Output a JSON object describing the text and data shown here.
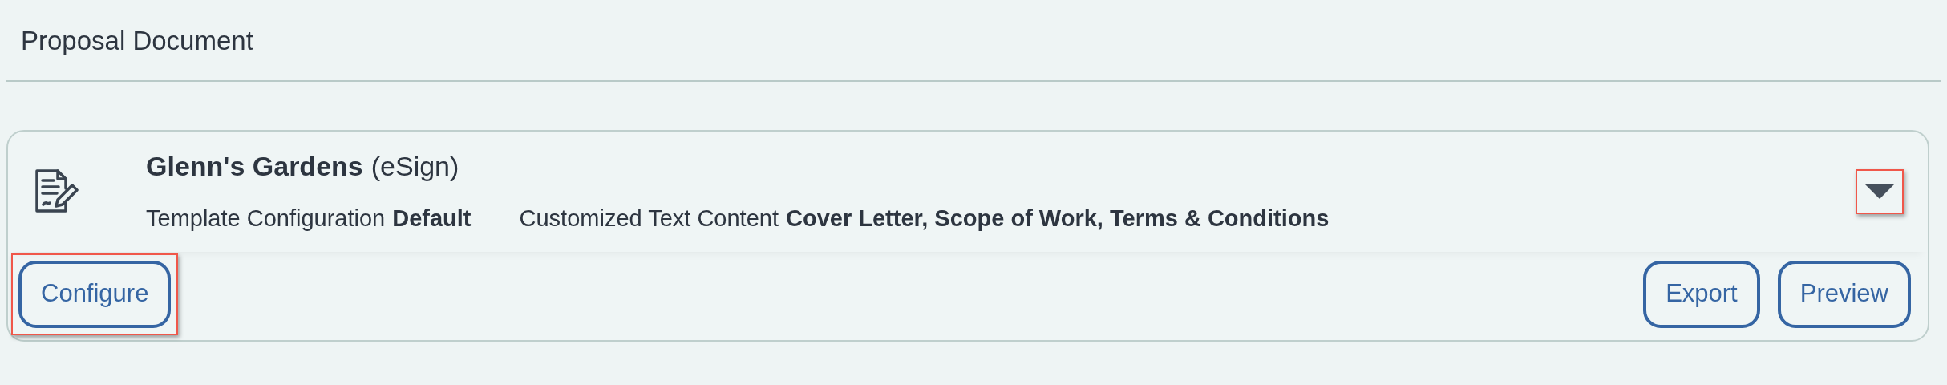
{
  "section": {
    "title": "Proposal Document"
  },
  "proposal": {
    "name": "Glenn's Gardens",
    "name_suffix": "(eSign)",
    "details": [
      {
        "label": "Template Configuration",
        "value": "Default"
      },
      {
        "label": "Customized Text Content",
        "value": "Cover Letter, Scope of Work, Terms & Conditions"
      }
    ],
    "toggle": {
      "expanded": false,
      "highlighted": true
    },
    "left_buttons": [
      {
        "label": "Configure",
        "highlighted": true
      }
    ],
    "right_buttons": [
      {
        "label": "Export",
        "highlighted": false
      },
      {
        "label": "Preview",
        "highlighted": false
      }
    ]
  }
}
